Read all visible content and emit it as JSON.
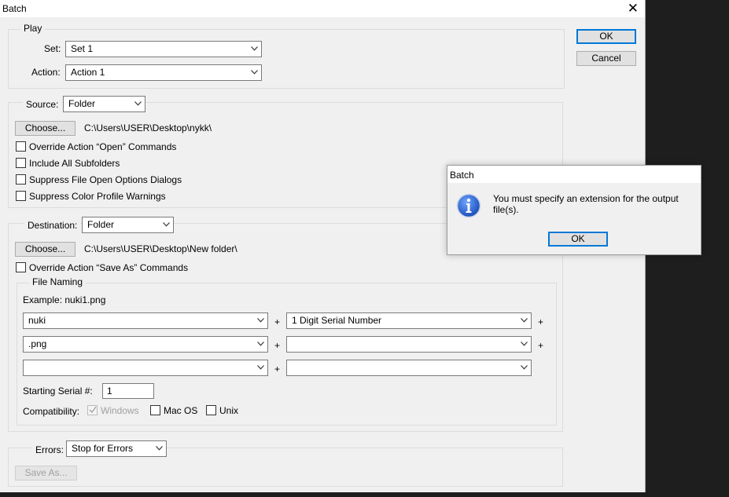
{
  "window": {
    "title": "Batch",
    "close_glyph": "✕"
  },
  "buttons": {
    "ok": "OK",
    "cancel": "Cancel"
  },
  "play": {
    "legend": "Play",
    "set_label": "Set:",
    "set_value": "Set 1",
    "action_label": "Action:",
    "action_value": "Action 1"
  },
  "source": {
    "label": "Source:",
    "value": "Folder",
    "choose": "Choose...",
    "path": "C:\\Users\\USER\\Desktop\\nykk\\",
    "checkboxes": [
      {
        "label": "Override Action “Open” Commands",
        "checked": false
      },
      {
        "label": "Include All Subfolders",
        "checked": false
      },
      {
        "label": "Suppress File Open Options Dialogs",
        "checked": false
      },
      {
        "label": "Suppress Color Profile Warnings",
        "checked": false
      }
    ]
  },
  "destination": {
    "label": "Destination:",
    "value": "Folder",
    "choose": "Choose...",
    "path": "C:\\Users\\USER\\Desktop\\New folder\\",
    "override_label": "Override Action “Save As” Commands",
    "file_naming": {
      "legend": "File Naming",
      "example": "Example: nuki1.png",
      "rows": [
        {
          "left": "nuki",
          "right": "1 Digit Serial Number"
        },
        {
          "left": ".png",
          "right": ""
        },
        {
          "left": "",
          "right": ""
        }
      ],
      "plus": "+",
      "serial_label": "Starting Serial #:",
      "serial_value": "1",
      "compat_label": "Compatibility:",
      "compat": [
        {
          "label": "Windows",
          "checked": true,
          "disabled": true
        },
        {
          "label": "Mac OS",
          "checked": false,
          "disabled": false
        },
        {
          "label": "Unix",
          "checked": false,
          "disabled": false
        }
      ]
    }
  },
  "errors": {
    "label": "Errors:",
    "value": "Stop for Errors",
    "save_as": "Save As..."
  },
  "alert": {
    "title": "Batch",
    "message": "You must specify an extension for the output file(s).",
    "ok": "OK",
    "icon": "info-icon"
  },
  "colors": {
    "accent": "#0078d7",
    "dialog_bg": "#f0f0f0",
    "backdrop": "#1e1e1e"
  }
}
